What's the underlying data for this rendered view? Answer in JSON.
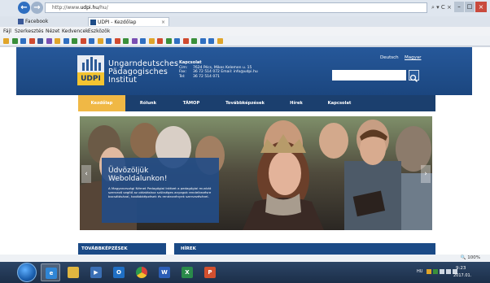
{
  "browser": {
    "url_prefix": "http://www.",
    "url_host": "udpi.hu",
    "url_suffix": "/hu/",
    "addr_tools": "⌕ ▾ C ×",
    "back_glyph": "←",
    "forward_glyph": "→",
    "tabs": [
      {
        "label": "Facebook",
        "icon_color": "#3b5998"
      },
      {
        "label": "UDPI - Kezdőlap",
        "icon_color": "#1f4d87"
      }
    ],
    "tab_close": "×",
    "menu": [
      "Fájl",
      "Szerkesztés",
      "Nézet",
      "Kedvencek",
      "Eszközök"
    ],
    "fav_icon_colors": [
      "#e0a52a",
      "#3a8f3a",
      "#2f6fc1",
      "#d04a2f",
      "#3b5998",
      "#7a4fb3",
      "#e0a52a",
      "#2f6fc1",
      "#3a8f3a",
      "#d04a2f",
      "#2f6fc1",
      "#e0a52a",
      "#2f6fc1",
      "#d04a2f",
      "#3a8f3a",
      "#7a4fb3",
      "#2f6fc1",
      "#e0a52a",
      "#d04a2f",
      "#3a8f3a",
      "#2f6fc1",
      "#d04a2f",
      "#3a8f3a",
      "#2f6fc1",
      "#2f6fc1",
      "#e0a52a"
    ],
    "zoom": "🔍 100%"
  },
  "site": {
    "logo_text": "UDPI",
    "title_lines": [
      "Ungarndeutsches",
      "Pädagogisches",
      "Institut"
    ],
    "contact": {
      "heading": "Kapcsolat",
      "rows": [
        {
          "label": "Cím:",
          "value": "7624 Pécs, Mikes Kelemen u. 15"
        },
        {
          "label": "Fax:",
          "value": "36 72 514 072 Email: info@udpi.hu"
        },
        {
          "label": "Tel:",
          "value": "36 72 514 071"
        }
      ]
    },
    "lang_de": "Deutsch",
    "lang_hu": "Magyar",
    "search_placeholder": "",
    "nav": [
      "Kezdőlap",
      "Rólunk",
      "TÁMOP",
      "Továbbképzések",
      "Hírek",
      "Kapcsolat"
    ],
    "welcome_title_lines": [
      "Üdvözöljük",
      "Weboldalunkon!"
    ],
    "welcome_text": "A Magyarországi Német Pedagógiai Intézet  a pedagógiai munkát szervező segítő az oktatáshoz szükséges anyagok rendelkezésre bocsátásával, továbbképzések és rendezvények szervezésével.",
    "slider_prev": "‹",
    "slider_next": "›",
    "section_trainings": "TOVÁBBKÉPZÉSEK",
    "section_news": "HÍREK"
  },
  "taskbar": {
    "apps": [
      {
        "name": "ie",
        "color": "#2f86d6",
        "glyph": "e",
        "open": true
      },
      {
        "name": "explorer",
        "color": "#e0b640",
        "glyph": "",
        "open": false
      },
      {
        "name": "media",
        "color": "#3a6fb5",
        "glyph": "▶",
        "open": false
      },
      {
        "name": "outlook",
        "color": "#1f6fc4",
        "glyph": "O",
        "open": false
      },
      {
        "name": "chrome",
        "color": "#e8a12c",
        "glyph": "",
        "open": false
      },
      {
        "name": "word",
        "color": "#2b5db6",
        "glyph": "W",
        "open": false
      },
      {
        "name": "excel",
        "color": "#2a8a4a",
        "glyph": "X",
        "open": false
      },
      {
        "name": "powerpoint",
        "color": "#d2502f",
        "glyph": "P",
        "open": false
      }
    ],
    "tray_lang": "HU",
    "tray_icon_colors": [
      "#e0a52a",
      "#3a8f3a",
      "#cfd8e3",
      "#cfd8e3",
      "#cfd8e3"
    ],
    "clock_time": "9:23",
    "clock_date": "2017.01."
  },
  "colors": {
    "header_blue": "#1f4d87",
    "nav_dark": "#1b3f6e",
    "nav_active": "#f0b845",
    "logo_yellow": "#f4c430"
  }
}
